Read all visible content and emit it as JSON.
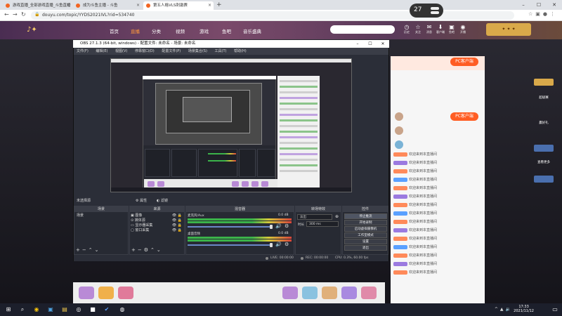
{
  "browser": {
    "tabs": [
      {
        "title": "游戏直播_全部游戏直播_斗鱼直播"
      },
      {
        "title": "成为斗鱼主播 - 斗鱼"
      },
      {
        "title": "第五人格VLS刺激赛"
      }
    ],
    "url": "douyu.com/topic/YYDS2021IVL?rid=534740",
    "timer_value": "27"
  },
  "site": {
    "nav": [
      "首页",
      "直播",
      "分类",
      "视频",
      "游戏",
      "鱼吧",
      "音乐盛典"
    ],
    "search_placeholder": "",
    "header_icons": [
      {
        "glyph": "◷",
        "label": "历史"
      },
      {
        "glyph": "☆",
        "label": "关注"
      },
      {
        "glyph": "✉",
        "label": "消息"
      },
      {
        "glyph": "⬇",
        "label": "客户端"
      },
      {
        "glyph": "▣",
        "label": "鱼吧"
      },
      {
        "glyph": "◉",
        "label": "开播"
      }
    ],
    "pc_button": "PC客户端",
    "chat_lines": [
      "欢迎来到本直播间",
      "欢迎来到本直播间",
      "欢迎来到本直播间",
      "欢迎来到本直播间",
      "欢迎来到本直播间",
      "欢迎来到本直播间",
      "欢迎来到本直播间",
      "欢迎来到本直播间",
      "欢迎来到本直播间",
      "欢迎来到本直播间",
      "欢迎来到本直播间",
      "欢迎来到本直播间",
      "欢迎来到本直播间",
      "欢迎来到本直播间",
      "欢迎来到本直播间"
    ],
    "right_strip": [
      "超级赛",
      "赢好礼",
      "查看更多"
    ]
  },
  "obs": {
    "title": "OBS 27.1.3 (64-bit, windows) - 配置文件: 未命名 - 场景: 未命名",
    "menu": [
      "文件(F)",
      "编辑(E)",
      "视图(V)",
      "停靠窗口(D)",
      "配置文件(P)",
      "场景集合(S)",
      "工具(T)",
      "帮助(H)"
    ],
    "scene_label": "未选择源",
    "tab_props": "属性",
    "tab_filters": "滤镜",
    "docks": {
      "scenes": {
        "title": "场景",
        "items": [
          "场景"
        ]
      },
      "sources": {
        "title": "来源",
        "items": [
          "图像",
          "媒体源",
          "显示器采集",
          "窗口采集"
        ]
      },
      "mixer": {
        "title": "混音器",
        "channels": [
          {
            "name": "麦克风/Aux",
            "db": "0.0 dB"
          },
          {
            "name": "桌面音频",
            "db": "0.0 dB"
          }
        ]
      },
      "transitions": {
        "title": "转场特效",
        "type": "淡出",
        "duration_label": "时长",
        "duration_value": "300 ms"
      },
      "controls": {
        "title": "控件",
        "buttons": [
          "停止推流",
          "开始录制",
          "启动虚拟摄像机",
          "工作室模式",
          "设置",
          "退出"
        ]
      }
    },
    "status": {
      "live": "LIVE: 00:00:00",
      "rec": "REC: 00:00:00",
      "cpu": "CPU: 0.3%, 60.00 fps"
    }
  },
  "taskbar": {
    "time": "17:33",
    "date": "2021/11/12"
  }
}
